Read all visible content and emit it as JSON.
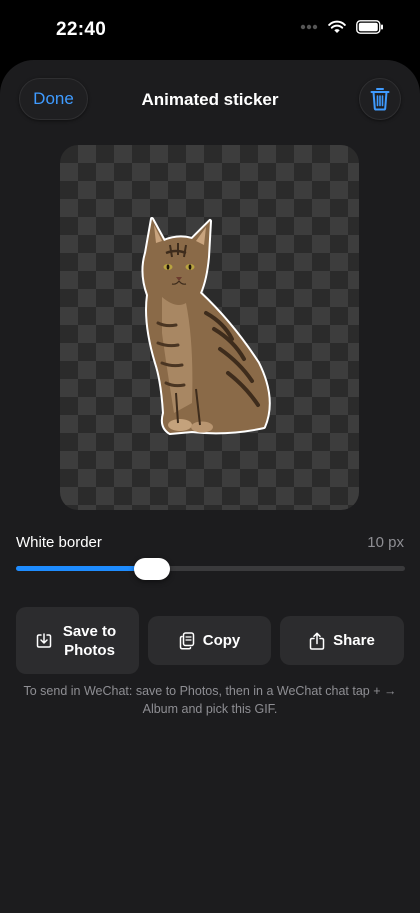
{
  "status_bar": {
    "time": "22:40"
  },
  "header": {
    "done_label": "Done",
    "title": "Animated sticker"
  },
  "border_control": {
    "label": "White border",
    "value_text": "10 px",
    "level_fraction": 0.35
  },
  "actions": {
    "save_label_line1": "Save to",
    "save_label_line2": "Photos",
    "copy_label": "Copy",
    "share_label": "Share"
  },
  "hint_text": "To send in WeChat: save to Photos, then in a WeChat chat tap + → Album and pick this GIF.",
  "colors": {
    "accent": "#3f9bff",
    "slider_fill": "#1e8cff",
    "sheet_background": "#1c1c1e"
  },
  "icons": {
    "trash": "trash-icon",
    "save": "save-to-photos-icon",
    "copy": "copy-icon",
    "share": "share-icon"
  }
}
